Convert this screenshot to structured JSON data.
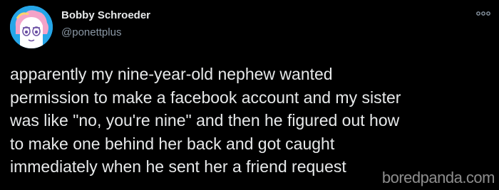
{
  "tweet": {
    "author_name": "Bobby Schroeder",
    "author_handle": "@ponettplus",
    "lines": [
      "apparently my nine-year-old nephew wanted",
      "permission to make a facebook account and my sister",
      "was like \"no, you're nine\" and then he figured out how",
      "to make one behind her back and got caught",
      "immediately when he sent her a friend request"
    ],
    "more_icon": "more-horizontal-icon"
  },
  "watermark": {
    "text": "boredpanda.com"
  },
  "colors": {
    "background": "#000000",
    "text": "#e7e9ea",
    "secondary_text": "#8b98a5",
    "avatar_bg": "#1d9bf0",
    "avatar_art": "#ffffff",
    "avatar_accent": "#f4a3c8"
  }
}
